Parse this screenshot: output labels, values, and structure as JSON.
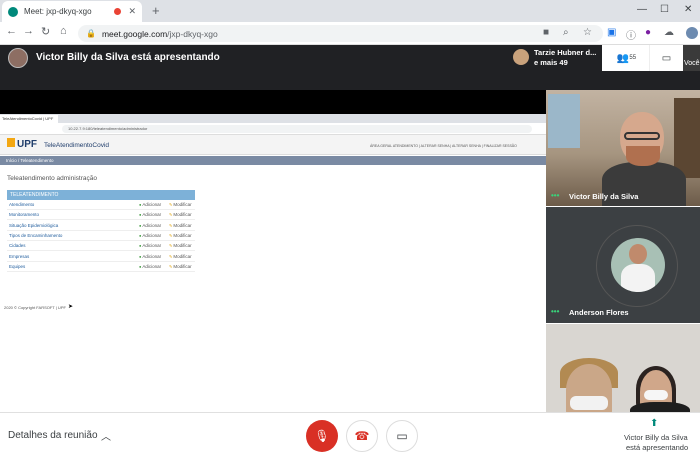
{
  "browser": {
    "tab_title": "Meet: jxp-dkyq-xgo",
    "tab_close": "✕",
    "new_tab": "+",
    "win_min": "—",
    "win_max": "☐",
    "win_close": "✕",
    "url_host": "meet.google.com",
    "url_path": "/jxp-dkyq-xgo",
    "back": "←",
    "forward": "→",
    "reload": "↻"
  },
  "meet": {
    "presenting_title": "Victor Billy da Silva está apresentando",
    "attendee_name": "Tarzie Hubner d...",
    "attendee_more": "e mais 49",
    "participants_count": "55",
    "self_label": "Você",
    "tiles": [
      {
        "name": "Victor Billy da Silva"
      },
      {
        "name": "Anderson Flores"
      }
    ],
    "details_label": "Detalhes da reunião",
    "presenter_line1": "Victor Billy da Silva",
    "presenter_line2": "está apresentando"
  },
  "shared_screen": {
    "tab_title": "TeleAtendimentoCovid | UPF",
    "url": "10.22.7.9:180/teleatendimento/administrador",
    "logo_text": "UPF",
    "app_title": "TeleAtendimentoCovid",
    "nav_links": "ÁREA GERAL ATENDIMENTO | ALTERAR SENHA | ALTERAR SENHA | FINALIZAR SESSÃO",
    "breadcrumb": "Início / Teleatendimento",
    "page_title": "Teleatendimento administração",
    "table_header": "TELEATENDIMENTO",
    "add_label": "Adicionar",
    "edit_label": "Modificar",
    "rows": [
      "Atendimento",
      "Monitoramento",
      "Situação Epidemiológica",
      "Tipos de Encaminhamento",
      "Cidades",
      "Empresas",
      "Equipes"
    ],
    "footer": "2020 © Copyright FARSOFT | UPF"
  },
  "colors": {
    "meet_dark": "#202124",
    "accent_green": "#00897b",
    "danger_red": "#d93025"
  }
}
